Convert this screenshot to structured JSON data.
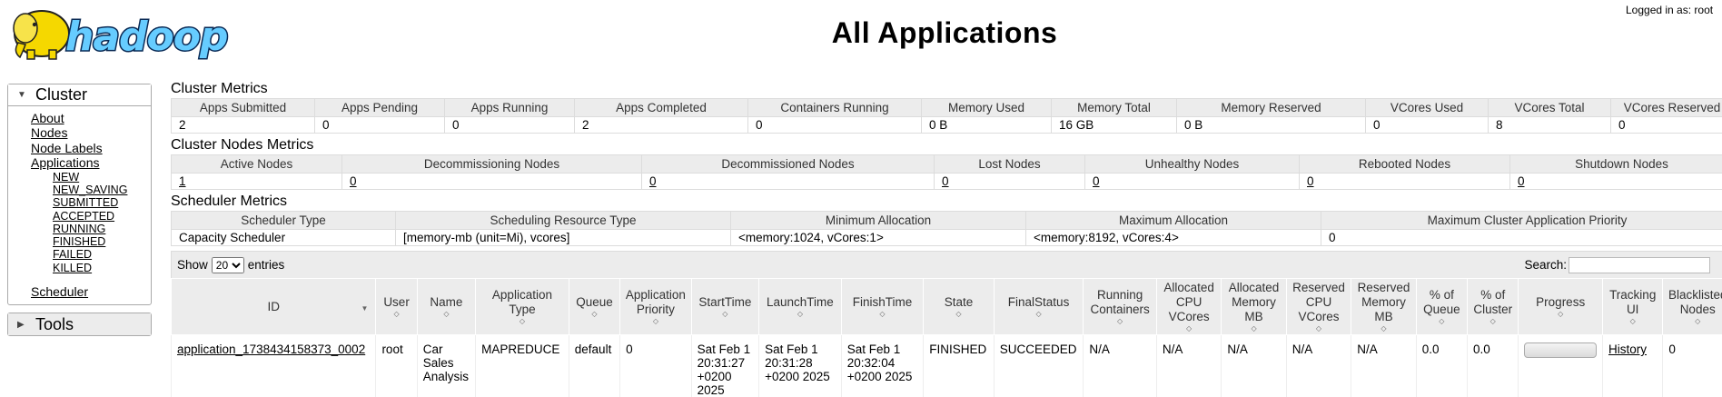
{
  "header": {
    "logo_text": "hadoop",
    "title": "All Applications",
    "login": "Logged in as: root"
  },
  "nav": {
    "cluster": {
      "label": "Cluster",
      "items": [
        "About",
        "Nodes",
        "Node Labels",
        "Applications"
      ],
      "app_states": [
        "NEW",
        "NEW_SAVING",
        "SUBMITTED",
        "ACCEPTED",
        "RUNNING",
        "FINISHED",
        "FAILED",
        "KILLED"
      ],
      "scheduler": "Scheduler"
    },
    "tools": {
      "label": "Tools"
    }
  },
  "cluster_metrics": {
    "title": "Cluster Metrics",
    "headers": [
      "Apps Submitted",
      "Apps Pending",
      "Apps Running",
      "Apps Completed",
      "Containers Running",
      "Memory Used",
      "Memory Total",
      "Memory Reserved",
      "VCores Used",
      "VCores Total",
      "VCores Reserved"
    ],
    "values": [
      "2",
      "0",
      "0",
      "2",
      "0",
      "0 B",
      "16 GB",
      "0 B",
      "0",
      "8",
      "0"
    ]
  },
  "node_metrics": {
    "title": "Cluster Nodes Metrics",
    "headers": [
      "Active Nodes",
      "Decommissioning Nodes",
      "Decommissioned Nodes",
      "Lost Nodes",
      "Unhealthy Nodes",
      "Rebooted Nodes",
      "Shutdown Nodes"
    ],
    "values": [
      "1",
      "0",
      "0",
      "0",
      "0",
      "0",
      "0"
    ]
  },
  "scheduler_metrics": {
    "title": "Scheduler Metrics",
    "headers": [
      "Scheduler Type",
      "Scheduling Resource Type",
      "Minimum Allocation",
      "Maximum Allocation",
      "Maximum Cluster Application Priority"
    ],
    "values": [
      "Capacity Scheduler",
      "[memory-mb (unit=Mi), vcores]",
      "<memory:1024, vCores:1>",
      "<memory:8192, vCores:4>",
      "0"
    ]
  },
  "apps": {
    "show_label": "Show",
    "entries_value": "20",
    "entries_label": "entries",
    "search_label": "Search:",
    "headers": [
      "ID",
      "User",
      "Name",
      "Application Type",
      "Queue",
      "Application Priority",
      "StartTime",
      "LaunchTime",
      "FinishTime",
      "State",
      "FinalStatus",
      "Running Containers",
      "Allocated CPU VCores",
      "Allocated Memory MB",
      "Reserved CPU VCores",
      "Reserved Memory MB",
      "% of Queue",
      "% of Cluster",
      "Progress",
      "Tracking UI",
      "Blacklisted Nodes"
    ],
    "rows": [
      {
        "id": "application_1738434158373_0002",
        "user": "root",
        "name": "Car Sales Analysis",
        "type": "MAPREDUCE",
        "queue": "default",
        "priority": "0",
        "start": "Sat Feb 1 20:31:27 +0200 2025",
        "launch": "Sat Feb 1 20:31:28 +0200 2025",
        "finish": "Sat Feb 1 20:32:04 +0200 2025",
        "state": "FINISHED",
        "final_status": "SUCCEEDED",
        "running_containers": "N/A",
        "alloc_vcores": "N/A",
        "alloc_mem": "N/A",
        "res_vcores": "N/A",
        "res_mem": "N/A",
        "pct_queue": "0.0",
        "pct_cluster": "0.0",
        "progress": 1.0,
        "tracking": "History",
        "blacklisted": "0"
      }
    ]
  },
  "colors": {
    "header_bg": "#ececec",
    "logo_yellow": "#f5d800",
    "logo_blue": "#66ccff"
  }
}
